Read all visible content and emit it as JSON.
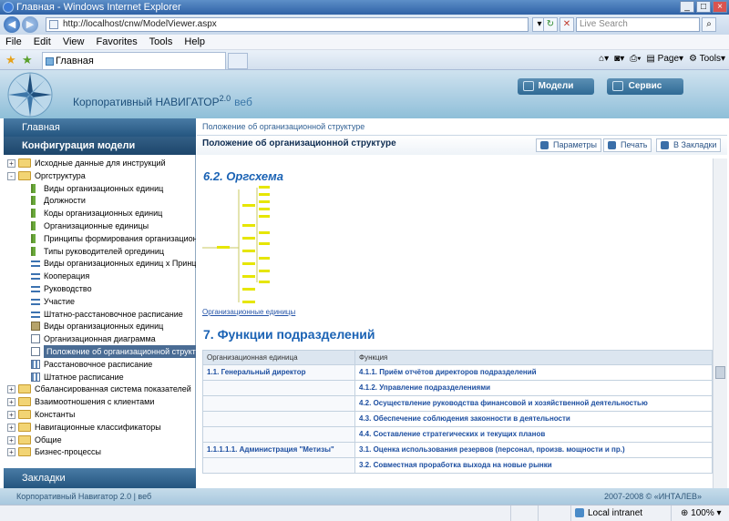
{
  "window": {
    "title": "Главная - Windows Internet Explorer"
  },
  "browser": {
    "url": "http://localhost/cnw/ModelViewer.aspx",
    "search_placeholder": "Live Search",
    "menu": [
      "File",
      "Edit",
      "View",
      "Favorites",
      "Tools",
      "Help"
    ],
    "tab_title": "Главная",
    "cmd": {
      "page": "Page",
      "tools": "Tools"
    }
  },
  "header": {
    "brand_main": "Корпоративный  НАВИГАТОР",
    "brand_version": "2.0",
    "brand_suffix": "веб",
    "buttons": [
      "Модели",
      "Сервис"
    ]
  },
  "left": {
    "home": "Главная",
    "config": "Конфигурация модели",
    "footer": "Закладки",
    "tree": [
      {
        "label": "Исходные данные для инструкций",
        "level": 0,
        "icon": "folder",
        "toggle": "+"
      },
      {
        "label": "Оргструктура",
        "level": 0,
        "icon": "folder",
        "toggle": "-"
      },
      {
        "label": "Виды организационных единиц",
        "level": 1,
        "icon": "org"
      },
      {
        "label": "Должности",
        "level": 1,
        "icon": "org"
      },
      {
        "label": "Коды организационных единиц",
        "level": 1,
        "icon": "org"
      },
      {
        "label": "Организационные единицы",
        "level": 1,
        "icon": "org"
      },
      {
        "label": "Принципы формирования организационных ед",
        "level": 1,
        "icon": "org"
      },
      {
        "label": "Типы руководителей оргединиц",
        "level": 1,
        "icon": "org"
      },
      {
        "label": "Виды организационных единиц x Принципы фо",
        "level": 1,
        "icon": "arrow"
      },
      {
        "label": "Кооперация",
        "level": 1,
        "icon": "arrow"
      },
      {
        "label": "Руководство",
        "level": 1,
        "icon": "arrow"
      },
      {
        "label": "Участие",
        "level": 1,
        "icon": "arrow"
      },
      {
        "label": "Штатно-расстановочное расписание",
        "level": 1,
        "icon": "arrow"
      },
      {
        "label": "Виды организационных единиц",
        "level": 1,
        "icon": "book"
      },
      {
        "label": "Организационная диаграмма",
        "level": 1,
        "icon": "doc"
      },
      {
        "label": "Положение об организационной структуре",
        "level": 1,
        "icon": "doc",
        "selected": true
      },
      {
        "label": "Расстановочное расписание",
        "level": 1,
        "icon": "grid"
      },
      {
        "label": "Штатное расписание",
        "level": 1,
        "icon": "grid"
      },
      {
        "label": "Сбалансированная система показателей",
        "level": 0,
        "icon": "folder",
        "toggle": "+"
      },
      {
        "label": "Взаимоотношения с клиентами",
        "level": 0,
        "icon": "folder",
        "toggle": "+"
      },
      {
        "label": "Константы",
        "level": 0,
        "icon": "folder",
        "toggle": "+"
      },
      {
        "label": "Навигационные классификаторы",
        "level": 0,
        "icon": "folder",
        "toggle": "+"
      },
      {
        "label": "Общие",
        "level": 0,
        "icon": "folder",
        "toggle": "+"
      },
      {
        "label": "Бизнес-процессы",
        "level": 0,
        "icon": "folder",
        "toggle": "+"
      }
    ]
  },
  "main": {
    "breadcrumb": "Положение об организационной структуре",
    "title": "Положение об организационной структуре",
    "actions": [
      "Параметры",
      "Печать",
      "В Закладки"
    ],
    "section_62": "6.2. Оргсхема",
    "org_caption": "Организационные единицы",
    "section_7": "7. Функции подразделений",
    "table": {
      "headers": [
        "Организационная единица",
        "Функция"
      ],
      "rows": [
        [
          "1.1. Генеральный директор",
          "4.1.1. Приём отчётов директоров подразделений"
        ],
        [
          "",
          "4.1.2. Управление подразделениями"
        ],
        [
          "",
          "4.2. Осуществление руководства финансовой и хозяйственной деятельностью"
        ],
        [
          "",
          "4.3. Обеспечение соблюдения законности в деятельности"
        ],
        [
          "",
          "4.4. Составление стратегических и текущих планов"
        ],
        [
          "1.1.1.1.1. Администрация \"Метизы\"",
          "3.1. Оценка использования резервов (персонал, произв. мощности и пр.)"
        ],
        [
          "",
          "3.2. Совместная проработка выхода на новые рынки"
        ]
      ]
    }
  },
  "footer": {
    "left": "Корпоративный Навигатор 2.0 | веб",
    "right": "2007-2008 © «ИНТАЛЕВ»"
  },
  "status": {
    "zone": "Local intranet",
    "zoom": "100%"
  }
}
